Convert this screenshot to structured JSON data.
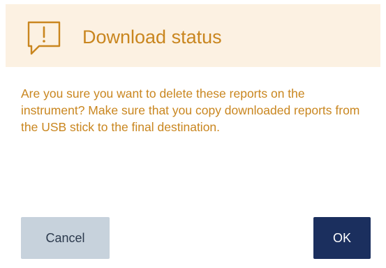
{
  "dialog": {
    "title": "Download status",
    "icon": "alert-speech-bubble-icon",
    "message": "Are you sure you want to delete these reports on the instrument? Make sure that you copy downloaded reports from the USB stick to the final destination.",
    "cancel_label": "Cancel",
    "ok_label": "OK"
  },
  "colors": {
    "header_background": "#fcf1e2",
    "accent_text": "#c9861f",
    "cancel_button": "#c7d2dc",
    "ok_button": "#1b2f5e"
  }
}
